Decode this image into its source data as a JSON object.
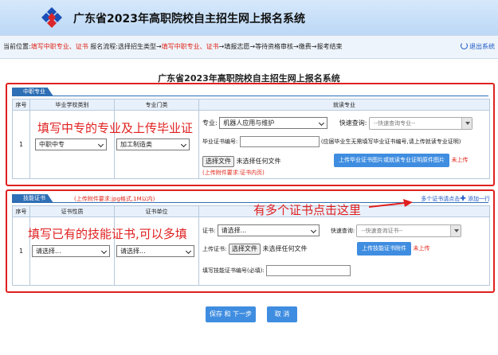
{
  "header": {
    "title": "广东省2023年高职院校自主招生网上报名系统"
  },
  "crumbs": {
    "prefix": "当前位置:",
    "current": "填写中职专业、证书",
    "flow_label": "报名流程:",
    "step1": "选择招生类型",
    "step2": "填写中职专业、证书",
    "step3": "填报志愿",
    "step4": "等待资格审核",
    "step5": "缴费",
    "step6": "报考结束",
    "arrow": "→",
    "logout": "退出系统"
  },
  "page_title": "广东省2023年高职院校自主招生网上报名系统",
  "section1": {
    "tab": "中职专业",
    "headers": [
      "序号",
      "毕业学校类别",
      "专业门类",
      "就读专业"
    ],
    "row": {
      "index": "1",
      "school_type": "中职中专",
      "category": "加工制造类",
      "major_label": "专业:",
      "major_value": "机器人应用与维护",
      "quick_label": "快速查询:",
      "quick_placeholder": "--快速查询专业--",
      "cert_no_label": "毕业证书编号:",
      "cert_no_value": "",
      "cert_no_note": "(应届毕业生无需填写毕业证书编号,请上传就读专业证明)",
      "choose_file": "选择文件",
      "no_file": "未选择任何文件",
      "upload_btn": "上传毕业证书图片或就读专业证明原件图片",
      "not_uploaded": "未上传",
      "upload_hint": "(上传附件要求:证书内页)"
    }
  },
  "section2": {
    "tab": "技能证书",
    "tab_note": "(上传附件要求:jpg格式,1M以内)",
    "more_link": "多个证书请点击",
    "add_row": "添加一行",
    "headers": [
      "序号",
      "证书性质",
      "证书单位",
      ""
    ],
    "row": {
      "index": "1",
      "nature": "请选择...",
      "unit": "请选择...",
      "cert_label": "证书:",
      "cert_value": "请选择...",
      "quick_label": "快速查询:",
      "quick_placeholder": "--快速查询证书--",
      "upload_label": "上传证书:",
      "choose_file": "选择文件",
      "no_file": "未选择任何文件",
      "upload_btn": "上传技能证书附件",
      "not_uploaded": "未上传",
      "cert_no_label": "填写技能证书编号(必填):",
      "cert_no_value": ""
    }
  },
  "annotations": {
    "a1": "填写中专的专业及上传毕业证",
    "a2": "有多个证书点击这里",
    "a3": "填写已有的技能证书,可以多填"
  },
  "footer": {
    "save": "保存 和 下一步",
    "cancel": "取 消"
  },
  "colors": {
    "accent": "#3f8de0",
    "annotation": "#e02020",
    "tab": "#2f6fb5"
  }
}
